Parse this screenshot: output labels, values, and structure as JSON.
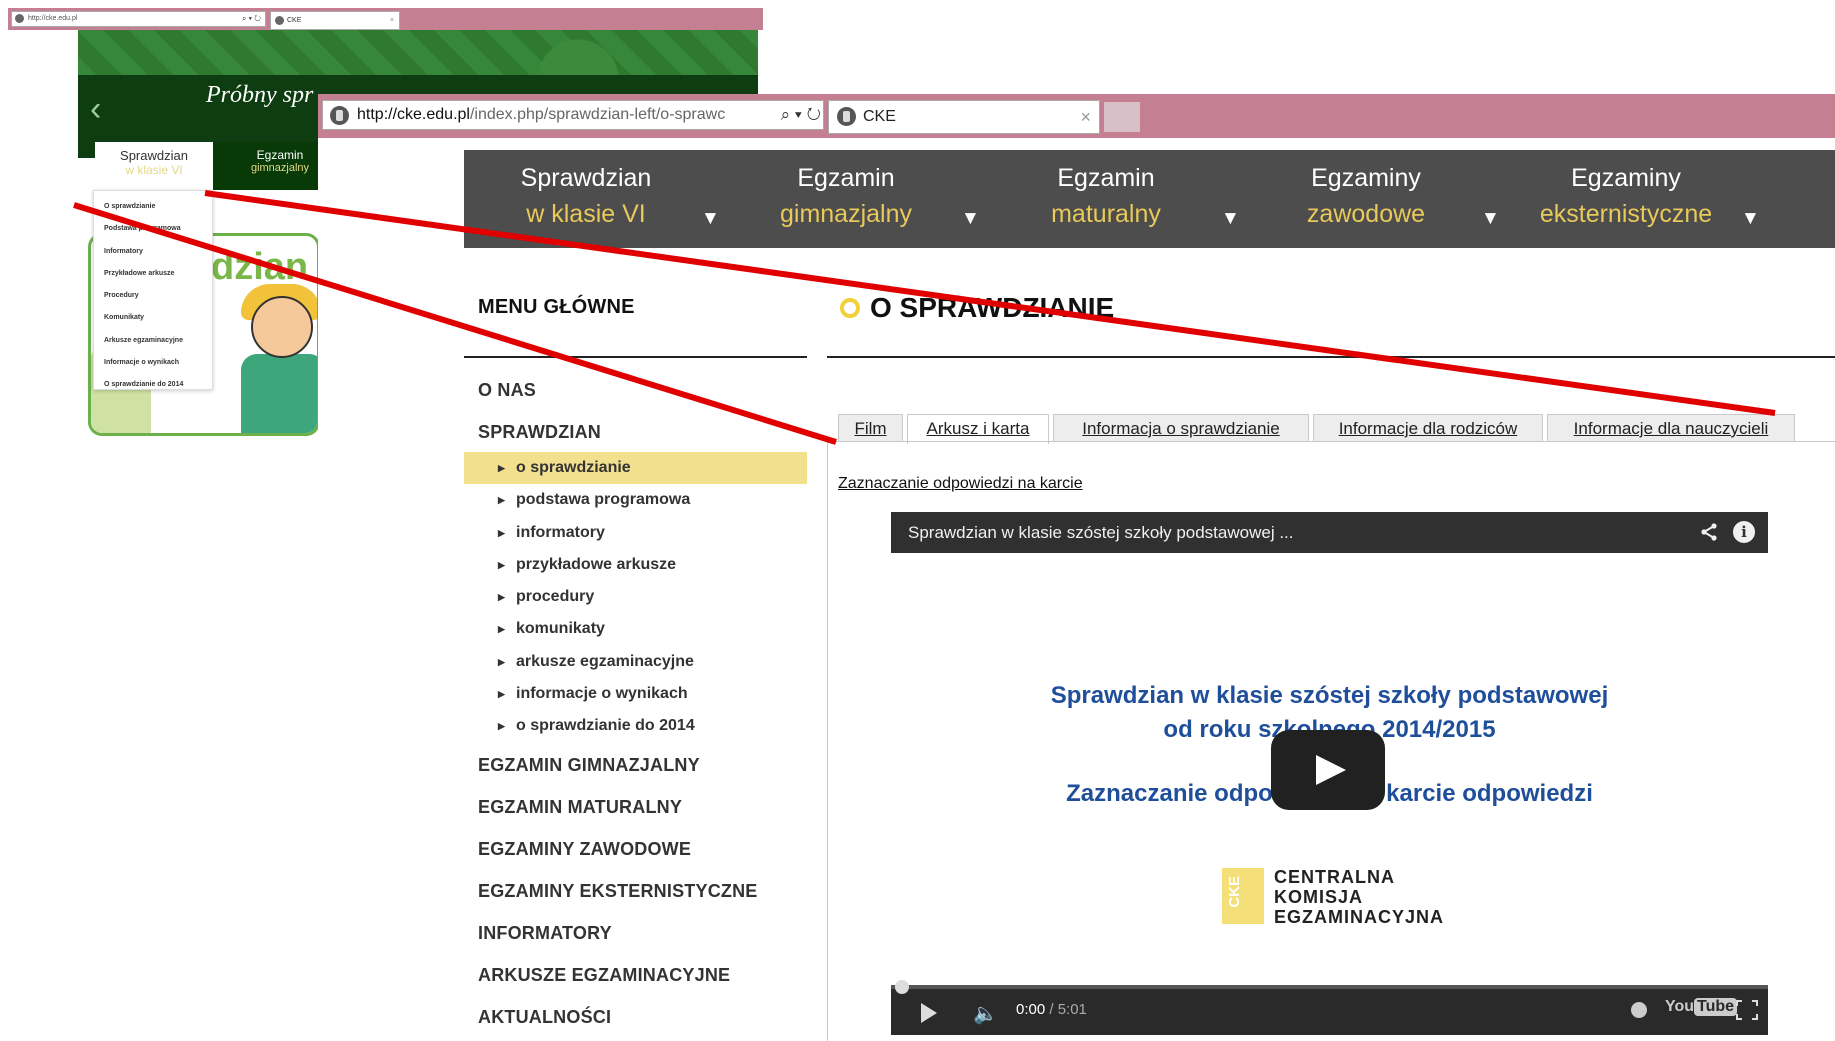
{
  "small_browser": {
    "address": "http://cke.edu.pl",
    "address_tools": "⌕ ▾ ↻",
    "tab_title": "CKE",
    "tab_close": "×",
    "banner_arrow": "‹",
    "banner_title": "Próbny spr",
    "nav": [
      {
        "line1": "Sprawdzian",
        "line2": "w klasie VI"
      },
      {
        "line1": "Egzamin",
        "line2": "gimnazjalny"
      }
    ],
    "card_word": "dzian",
    "dropdown": [
      "O sprawdzianie",
      "Podstawa programowa",
      "Informatory",
      "Przykładowe arkusze",
      "Procedury",
      "Komunikaty",
      "Arkusze egzaminacyjne",
      "Informacje o wynikach",
      "O sprawdzianie do 2014"
    ]
  },
  "browser": {
    "address_host": "http://cke.edu.pl",
    "address_path": "/index.php/sprawdzian-left/o-sprawc",
    "address_tools": "⌕ ▾ ↻",
    "tab_title": "CKE",
    "tab_close": "×"
  },
  "top_nav": [
    {
      "line1": "Sprawdzian",
      "line2": "w klasie VI",
      "arrow": "▼"
    },
    {
      "line1": "Egzamin",
      "line2": "gimnazjalny",
      "arrow": "▼"
    },
    {
      "line1": "Egzamin",
      "line2": "maturalny",
      "arrow": "▼"
    },
    {
      "line1": "Egzaminy",
      "line2": "zawodowe",
      "arrow": "▼"
    },
    {
      "line1": "Egzaminy",
      "line2": "eksternistyczne",
      "arrow": "▼"
    }
  ],
  "sidebar": {
    "heading": "MENU GŁÓWNE",
    "top_items": [
      "O NAS",
      "SPRAWDZIAN"
    ],
    "sub_items": [
      "o sprawdzianie",
      "podstawa programowa",
      "informatory",
      "przykładowe arkusze",
      "procedury",
      "komunikaty",
      "arkusze egzaminacyjne",
      "informacje o wynikach",
      "o sprawdzianie do 2014"
    ],
    "active_sub": "o sprawdzianie",
    "bottom_items": [
      "EGZAMIN GIMNAZJALNY",
      "EGZAMIN MATURALNY",
      "EGZAMINY ZAWODOWE",
      "EGZAMINY EKSTERNISTYCZNE",
      "INFORMATORY",
      "ARKUSZE EGZAMINACYJNE",
      "AKTUALNOŚCI"
    ]
  },
  "content": {
    "title": "O SPRAWDZIANIE",
    "tabs": [
      "Film",
      "Arkusz i karta",
      "Informacja o sprawdzianie",
      "Informacje dla rodziców",
      "Informacje dla nauczycieli"
    ],
    "active_tab": "Arkusz i karta",
    "link": "Zaznaczanie odpowiedzi na karcie"
  },
  "video": {
    "title": "Sprawdzian w klasie szóstej szkoły podstawowej ...",
    "slide_line1": "Sprawdzian w klasie szóstej szkoły podstawowej",
    "slide_line2": "od roku szkolnego 2014/2015",
    "slide_line3": "Zaznaczanie odpowiedzi na karcie odpowiedzi",
    "logo_mark": "CKE",
    "logo_lines": [
      "CENTRALNA",
      "KOMISJA",
      "EGZAMINACYJNA"
    ],
    "time_current": "0:00",
    "time_total": " / 5:01",
    "youtube_you": "You",
    "youtube_tube": "Tube",
    "progress": 0
  },
  "colors": {
    "chrome": "#c47f93",
    "nav_bg": "#4d4d4d",
    "nav_accent": "#e8c95a",
    "active_menu": "#f3e08f",
    "slide_text": "#1f4e9b",
    "annotation": "#e00000"
  },
  "icons": [
    "favicon-eagle-icon",
    "search-icon",
    "refresh-icon",
    "close-icon",
    "dropdown-arrow-icon",
    "share-icon",
    "info-icon",
    "play-icon",
    "volume-icon",
    "watch-later-icon",
    "fullscreen-icon"
  ]
}
